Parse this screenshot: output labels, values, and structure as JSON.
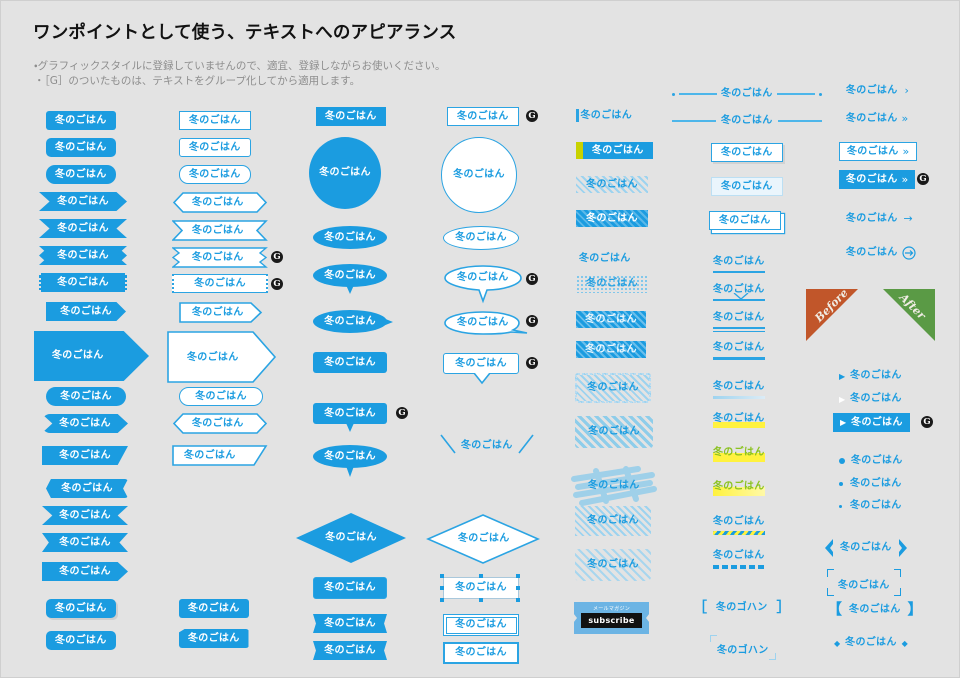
{
  "header": {
    "title": "ワンポイントとして使う、テキストへのアピアランス",
    "notes": [
      "・グラフィックスタイルに登録していませんので、適宜、登録しながらお使いください。",
      "・［G］のついたものは、テキストをグループ化してから適用します。"
    ]
  },
  "sample_text": "冬のごはん",
  "sample_text_kana": "冬のゴハン",
  "badge_label": "G",
  "ribbons": {
    "before": "Before",
    "after": "After"
  },
  "subscribe": {
    "caption": "メールマガジン",
    "button": "subscribe"
  },
  "colors": {
    "background": "#e3e3e3",
    "accent_blue": "#1b9ce0",
    "accent_blue_light": "#9dd3ef",
    "outline_blue": "#2ba4e3",
    "title_text": "#121212",
    "note_text": "#8d8d8d",
    "badge_bg": "#1a1a1a",
    "highlight_yellow": "#fff23e",
    "lime": "#c8d200",
    "green_text": "#8bc220",
    "before_ribbon": "#c1562a",
    "after_ribbon": "#5a9a45",
    "subscribe_bg": "#6cb4e4",
    "subscribe_button": "#111111"
  },
  "columns": {
    "col1_solid": [
      "rounded-rect",
      "rounded-rect-sm",
      "rounded-rect-lg",
      "chevron-left-right",
      "ribbon-banner",
      "zigzag-edge",
      "dotted-edge",
      "tag-right",
      "big-arrow",
      "pill",
      "hex-pill",
      "parallelogram",
      "pill-arrow",
      "ribbon-flag",
      "banner-notch",
      "arrow-tag",
      "rounded-solid",
      "shadow-solid",
      "rounded-solid-2",
      "soft-rect"
    ],
    "col2_outline": [
      "rect-outline",
      "rect-outline-2",
      "round-outline",
      "chevron-outline",
      "ribbon-outline",
      "zigzag-outline",
      "dotted-outline",
      "tag-outline",
      "big-arrow-outline",
      "pill-outline",
      "hex-outline",
      "parallelogram-outline",
      "solid-small",
      "solid-shadow-small"
    ],
    "col3_bubbles": [
      "solid-rect",
      "circle",
      "ellipse",
      "ellipse-tail",
      "ellipse-point",
      "rect-tail",
      "rect-tail-2",
      "ellipse-tail-2",
      "diamond",
      "rounded-inner",
      "notch-left",
      "notch-left-2"
    ],
    "col4_bubbles_outline": [
      "rect-outline",
      "circle-outline",
      "ellipse-outline",
      "ellipse-tail-outline",
      "ellipse-point-outline",
      "rect-tail-outline",
      "slash-marks",
      "diamond-outline",
      "anchor-points",
      "double-border",
      "double-border-2"
    ],
    "col5_patterns": [
      "bar-left",
      "lime-bar",
      "hatch-light",
      "hatch-solid",
      "plain-text",
      "dotted-box",
      "hatch-white-text",
      "hatch-white-text-2",
      "rough-hatch",
      "rough-hatch-2",
      "scribble",
      "hatch-soft",
      "hatch-soft-2",
      "subscribe-button"
    ],
    "col6_rules": [
      "rule-dots",
      "rule-plain",
      "box-shadow",
      "box-soft",
      "box-double",
      "underline",
      "underline-tail",
      "underline-double",
      "underline-thick",
      "underline-faded",
      "highlight-yellow",
      "highlight-yellow-bold",
      "highlight-gradient",
      "underline-hatch",
      "underline-dash",
      "brackets-wide",
      "corner-brackets"
    ],
    "col7_arrows": [
      "chevron-single",
      "chevron-double",
      "chevron-box",
      "chevron-solid",
      "arrow-right",
      "arrow-circle",
      "ribbon-before",
      "ribbon-after",
      "triangle-bullet",
      "triangle-bullet-white",
      "triangle-bullet-solid",
      "disc-bullet",
      "small-disc-bullet",
      "tiny-disc-bullet",
      "bold-brackets",
      "corner-quotes",
      "square-brackets",
      "diamond-marks"
    ]
  }
}
